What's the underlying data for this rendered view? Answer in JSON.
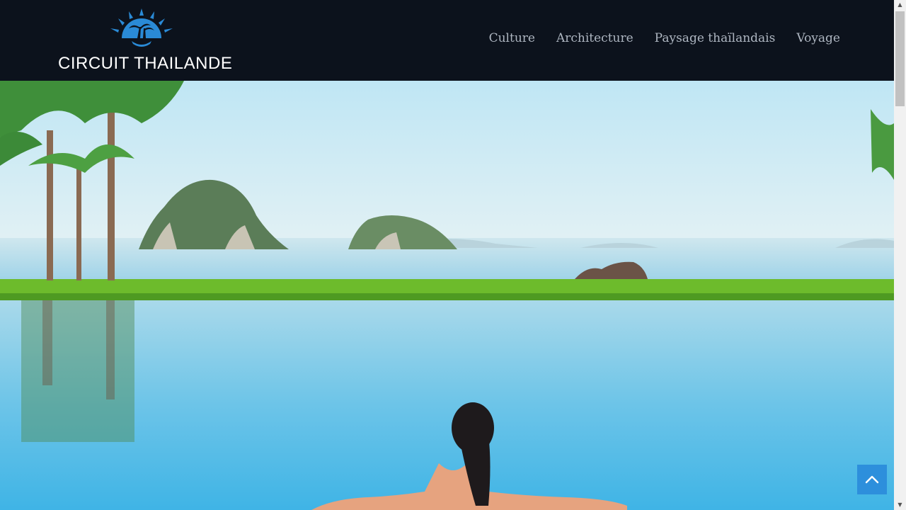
{
  "site": {
    "logo_text": "CIRCUIT THAILANDE",
    "logo_icon": "sun-palm-icon",
    "accent_color": "#2d8fdc"
  },
  "nav": {
    "items": [
      {
        "label": "Culture"
      },
      {
        "label": "Architecture"
      },
      {
        "label": "Paysage thaïlandais"
      },
      {
        "label": "Voyage"
      }
    ]
  },
  "hero": {
    "image": "infinity-pool-island-view"
  },
  "back_to_top": {
    "icon": "chevron-up-icon"
  },
  "scrollbar": {
    "up_icon": "arrow-up-icon",
    "down_icon": "arrow-down-icon"
  }
}
